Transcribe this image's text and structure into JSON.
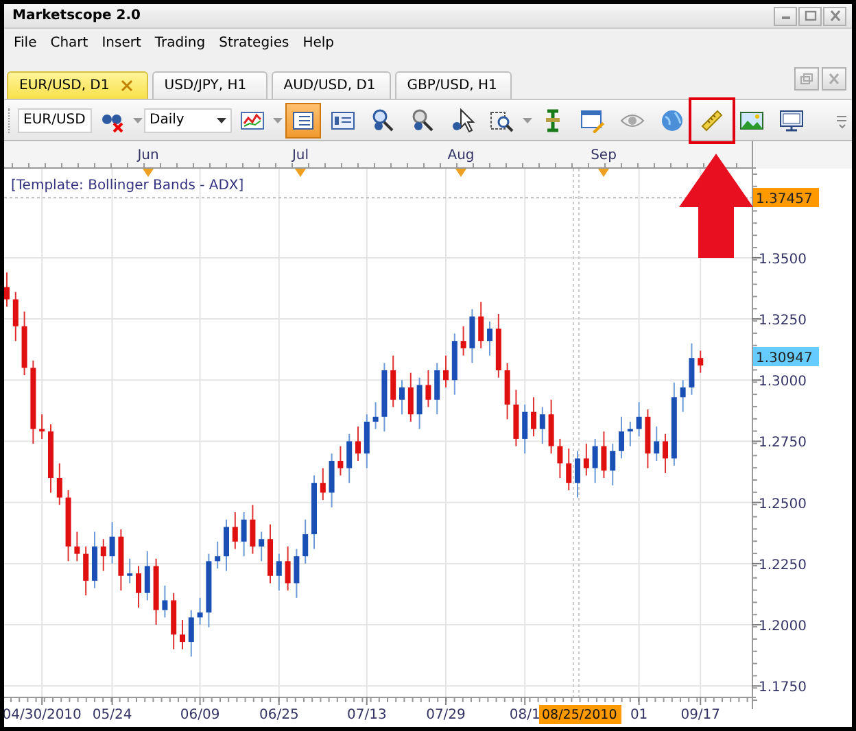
{
  "window": {
    "title": "Marketscope 2.0"
  },
  "menu": [
    "File",
    "Chart",
    "Insert",
    "Trading",
    "Strategies",
    "Help"
  ],
  "tabs": [
    {
      "label": "EUR/USD, D1",
      "selected": true
    },
    {
      "label": "USD/JPY, H1",
      "selected": false
    },
    {
      "label": "AUD/USD, D1",
      "selected": false
    },
    {
      "label": "GBP/USD, H1",
      "selected": false
    }
  ],
  "toolbar": [
    {
      "kind": "combo",
      "value": "EUR/USD"
    },
    {
      "kind": "button",
      "selected": false,
      "dropdown": true
    },
    {
      "kind": "combo",
      "value": "Daily"
    },
    {
      "kind": "button",
      "selected": false,
      "dropdown": true
    },
    {
      "kind": "button",
      "selected": true
    },
    {
      "kind": "button",
      "selected": false
    },
    {
      "kind": "button",
      "selected": false
    },
    {
      "kind": "button",
      "selected": false
    },
    {
      "kind": "button",
      "selected": false
    },
    {
      "kind": "button",
      "selected": false,
      "dropdown": true
    },
    {
      "kind": "button",
      "selected": false
    },
    {
      "kind": "button",
      "selected": false
    },
    {
      "kind": "button",
      "selected": false
    },
    {
      "kind": "button",
      "selected": false
    },
    {
      "kind": "button",
      "selected": false,
      "highlighted": true
    },
    {
      "kind": "button",
      "selected": false
    },
    {
      "kind": "button",
      "selected": false
    }
  ],
  "chart": {
    "template": "[Template: Bollinger Bands - ADX]",
    "months": [
      "Jun",
      "Jul",
      "Aug",
      "Sep"
    ],
    "cursor_date": "08/25/2010",
    "price_tags": [
      {
        "text": "1.37457",
        "color": "#ff9900"
      },
      {
        "text": "1.30947",
        "color": "#66ccff"
      }
    ],
    "chart_data": {
      "type": "candlestick",
      "categories": [
        null,
        null,
        null,
        null,
        "04/30/2010",
        null,
        null,
        null,
        null,
        null,
        null,
        null,
        "05/24",
        null,
        null,
        null,
        null,
        null,
        null,
        null,
        null,
        null,
        "06/09",
        null,
        null,
        null,
        null,
        null,
        null,
        null,
        null,
        "06/25",
        null,
        null,
        null,
        null,
        null,
        null,
        null,
        null,
        null,
        "07/13",
        null,
        null,
        null,
        null,
        null,
        null,
        null,
        null,
        "07/29",
        null,
        null,
        null,
        null,
        null,
        null,
        null,
        null,
        "08/1",
        null,
        null,
        null,
        null,
        null,
        null,
        null,
        null,
        null,
        null,
        null,
        null,
        "01",
        null,
        null,
        null,
        null,
        null,
        null,
        "09/17"
      ],
      "grid": true,
      "ref_lines": [
        {
          "axis": "y",
          "value": 1.37457
        }
      ],
      "ylim": [
        1.1706,
        1.3864
      ],
      "ohlc": [
        [
          1.338,
          1.344,
          1.33,
          1.333
        ],
        [
          1.333,
          1.336,
          1.316,
          1.322
        ],
        [
          1.322,
          1.328,
          1.302,
          1.305
        ],
        [
          1.305,
          1.308,
          1.274,
          1.28
        ],
        [
          1.28,
          1.286,
          1.276,
          1.279
        ],
        [
          1.279,
          1.282,
          1.254,
          1.26
        ],
        [
          1.26,
          1.266,
          1.249,
          1.252
        ],
        [
          1.252,
          1.255,
          1.226,
          1.232
        ],
        [
          1.232,
          1.238,
          1.226,
          1.229
        ],
        [
          1.229,
          1.232,
          1.212,
          1.218
        ],
        [
          1.218,
          1.238,
          1.215,
          1.232
        ],
        [
          1.232,
          1.235,
          1.222,
          1.228
        ],
        [
          1.228,
          1.242,
          1.225,
          1.236
        ],
        [
          1.236,
          1.239,
          1.214,
          1.22
        ],
        [
          1.22,
          1.227,
          1.217,
          1.221
        ],
        [
          1.221,
          1.224,
          1.207,
          1.213
        ],
        [
          1.213,
          1.23,
          1.21,
          1.224
        ],
        [
          1.224,
          1.227,
          1.2,
          1.206
        ],
        [
          1.206,
          1.216,
          1.203,
          1.21
        ],
        [
          1.21,
          1.213,
          1.19,
          1.196
        ],
        [
          1.196,
          1.202,
          1.19,
          1.193
        ],
        [
          1.193,
          1.206,
          1.187,
          1.203
        ],
        [
          1.203,
          1.211,
          1.2,
          1.205
        ],
        [
          1.205,
          1.229,
          1.199,
          1.226
        ],
        [
          1.226,
          1.234,
          1.223,
          1.228
        ],
        [
          1.228,
          1.243,
          1.222,
          1.24
        ],
        [
          1.24,
          1.246,
          1.231,
          1.234
        ],
        [
          1.234,
          1.246,
          1.228,
          1.243
        ],
        [
          1.243,
          1.249,
          1.229,
          1.232
        ],
        [
          1.232,
          1.238,
          1.226,
          1.235
        ],
        [
          1.235,
          1.241,
          1.217,
          1.22
        ],
        [
          1.22,
          1.229,
          1.214,
          1.226
        ],
        [
          1.226,
          1.232,
          1.214,
          1.217
        ],
        [
          1.217,
          1.231,
          1.211,
          1.228
        ],
        [
          1.228,
          1.243,
          1.225,
          1.237
        ],
        [
          1.237,
          1.261,
          1.231,
          1.258
        ],
        [
          1.258,
          1.264,
          1.251,
          1.254
        ],
        [
          1.254,
          1.27,
          1.248,
          1.267
        ],
        [
          1.267,
          1.273,
          1.261,
          1.264
        ],
        [
          1.264,
          1.278,
          1.258,
          1.275
        ],
        [
          1.275,
          1.281,
          1.267,
          1.27
        ],
        [
          1.27,
          1.286,
          1.264,
          1.283
        ],
        [
          1.283,
          1.291,
          1.28,
          1.285
        ],
        [
          1.285,
          1.307,
          1.279,
          1.304
        ],
        [
          1.304,
          1.31,
          1.289,
          1.292
        ],
        [
          1.292,
          1.3,
          1.286,
          1.297
        ],
        [
          1.297,
          1.303,
          1.283,
          1.286
        ],
        [
          1.286,
          1.301,
          1.28,
          1.298
        ],
        [
          1.298,
          1.304,
          1.289,
          1.292
        ],
        [
          1.292,
          1.307,
          1.286,
          1.304
        ],
        [
          1.304,
          1.31,
          1.297,
          1.3
        ],
        [
          1.3,
          1.319,
          1.294,
          1.316
        ],
        [
          1.316,
          1.322,
          1.31,
          1.313
        ],
        [
          1.313,
          1.329,
          1.307,
          1.326
        ],
        [
          1.326,
          1.332,
          1.313,
          1.316
        ],
        [
          1.316,
          1.324,
          1.31,
          1.321
        ],
        [
          1.321,
          1.327,
          1.301,
          1.304
        ],
        [
          1.304,
          1.307,
          1.284,
          1.29
        ],
        [
          1.29,
          1.296,
          1.273,
          1.276
        ],
        [
          1.276,
          1.29,
          1.27,
          1.287
        ],
        [
          1.287,
          1.293,
          1.277,
          1.28
        ],
        [
          1.28,
          1.289,
          1.274,
          1.286
        ],
        [
          1.286,
          1.292,
          1.27,
          1.273
        ],
        [
          1.273,
          1.276,
          1.26,
          1.266
        ],
        [
          1.266,
          1.272,
          1.255,
          1.258
        ],
        [
          1.258,
          1.271,
          1.252,
          1.268
        ],
        [
          1.268,
          1.274,
          1.261,
          1.264
        ],
        [
          1.264,
          1.276,
          1.258,
          1.273
        ],
        [
          1.273,
          1.279,
          1.26,
          1.263
        ],
        [
          1.263,
          1.274,
          1.257,
          1.271
        ],
        [
          1.271,
          1.285,
          1.268,
          1.279
        ],
        [
          1.279,
          1.283,
          1.273,
          1.28
        ],
        [
          1.28,
          1.291,
          1.277,
          1.285
        ],
        [
          1.285,
          1.288,
          1.264,
          1.27
        ],
        [
          1.27,
          1.281,
          1.267,
          1.275
        ],
        [
          1.275,
          1.278,
          1.262,
          1.268
        ],
        [
          1.268,
          1.299,
          1.265,
          1.293
        ],
        [
          1.293,
          1.3,
          1.287,
          1.297
        ],
        [
          1.297,
          1.315,
          1.294,
          1.309
        ],
        [
          1.309,
          1.312,
          1.303,
          1.306
        ]
      ],
      "yticks": [
        {
          "value": 1.35,
          "label": "1.3500"
        },
        {
          "value": 1.325,
          "label": "1.3250"
        },
        {
          "value": 1.3,
          "label": "1.3000"
        },
        {
          "value": 1.275,
          "label": "1.2750"
        },
        {
          "value": 1.25,
          "label": "1.2500"
        },
        {
          "value": 1.225,
          "label": "1.2250"
        },
        {
          "value": 1.2,
          "label": "1.2000"
        },
        {
          "value": 1.175,
          "label": "1.1750"
        }
      ]
    }
  }
}
